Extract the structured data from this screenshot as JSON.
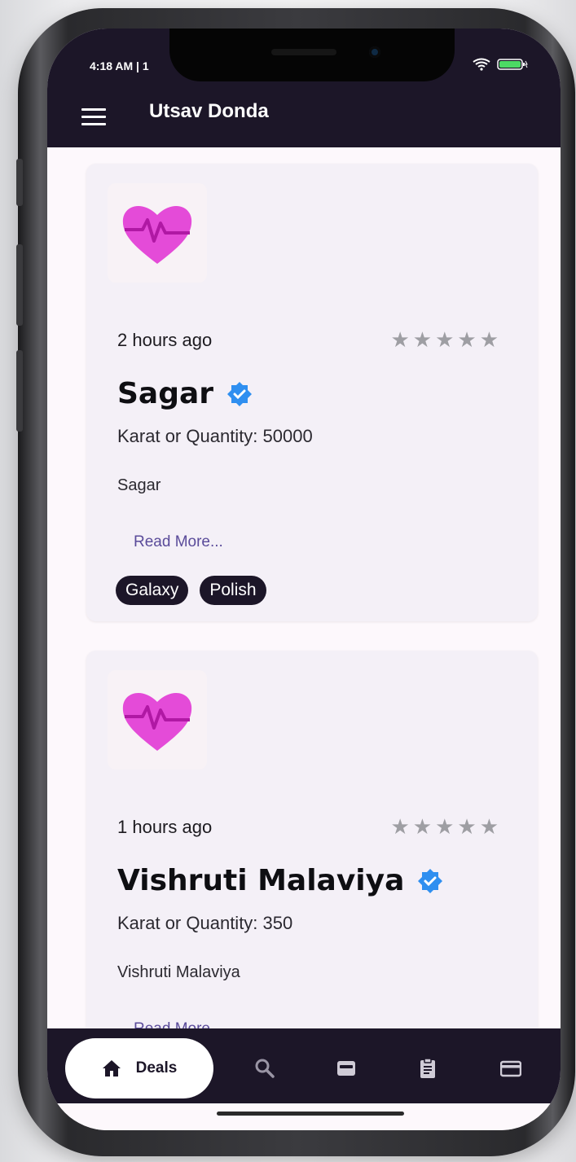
{
  "status_bar": {
    "time": "4:18 AM | 1"
  },
  "header": {
    "title": "Utsav Donda"
  },
  "deals": [
    {
      "time_ago": "2 hours ago",
      "name": "Sagar",
      "quantity": "Karat or Quantity: 50000",
      "description": "Sagar",
      "read_more": "Read More...",
      "rating": 0,
      "tags": [
        "Galaxy",
        "Polish"
      ]
    },
    {
      "time_ago": "1 hours ago",
      "name": "Vishruti Malaviya",
      "quantity": "Karat or Quantity: 350",
      "description": "Vishruti Malaviya",
      "read_more": "Read More...",
      "rating": 0,
      "tags": []
    }
  ],
  "bottom_nav": {
    "active_label": "Deals",
    "items": [
      "home-icon",
      "search-icon",
      "inbox-icon",
      "clipboard-icon",
      "credit-card-icon"
    ]
  },
  "colors": {
    "header_bg": "#1c1628",
    "card_bg": "#f4f0f7",
    "accent_link": "#5a4b9a",
    "verified": "#2f8ff0",
    "heart": "#e44bd8"
  }
}
